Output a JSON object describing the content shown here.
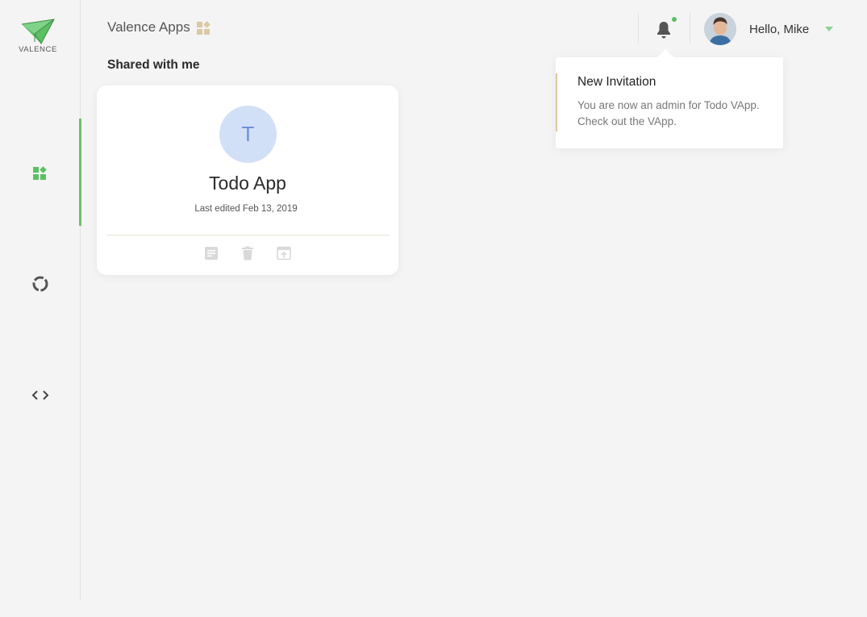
{
  "sidebar": {
    "logo_text": "VALENCE",
    "nav": [
      {
        "icon": "apps-icon",
        "active": true
      },
      {
        "icon": "spinner-icon",
        "active": false
      },
      {
        "icon": "code-icon",
        "active": false
      }
    ]
  },
  "header": {
    "brand": "Valence Apps",
    "greeting": "Hello, Mike",
    "notification_dot": true
  },
  "section": {
    "title": "Shared with me"
  },
  "card": {
    "avatar_letter": "T",
    "name": "Todo App",
    "meta": "Last edited Feb 13, 2019",
    "actions": [
      "details-icon",
      "delete-icon",
      "open-icon"
    ]
  },
  "notification": {
    "title": "New Invitation",
    "text": "You are now an admin for Todo VApp. Check out the VApp."
  },
  "colors": {
    "accent_green": "#6cc070",
    "brand_tan": "#dac9a3",
    "avatar_bg": "#d2e0f7",
    "avatar_letter": "#6f8fd8",
    "background": "#f4f4f4"
  }
}
